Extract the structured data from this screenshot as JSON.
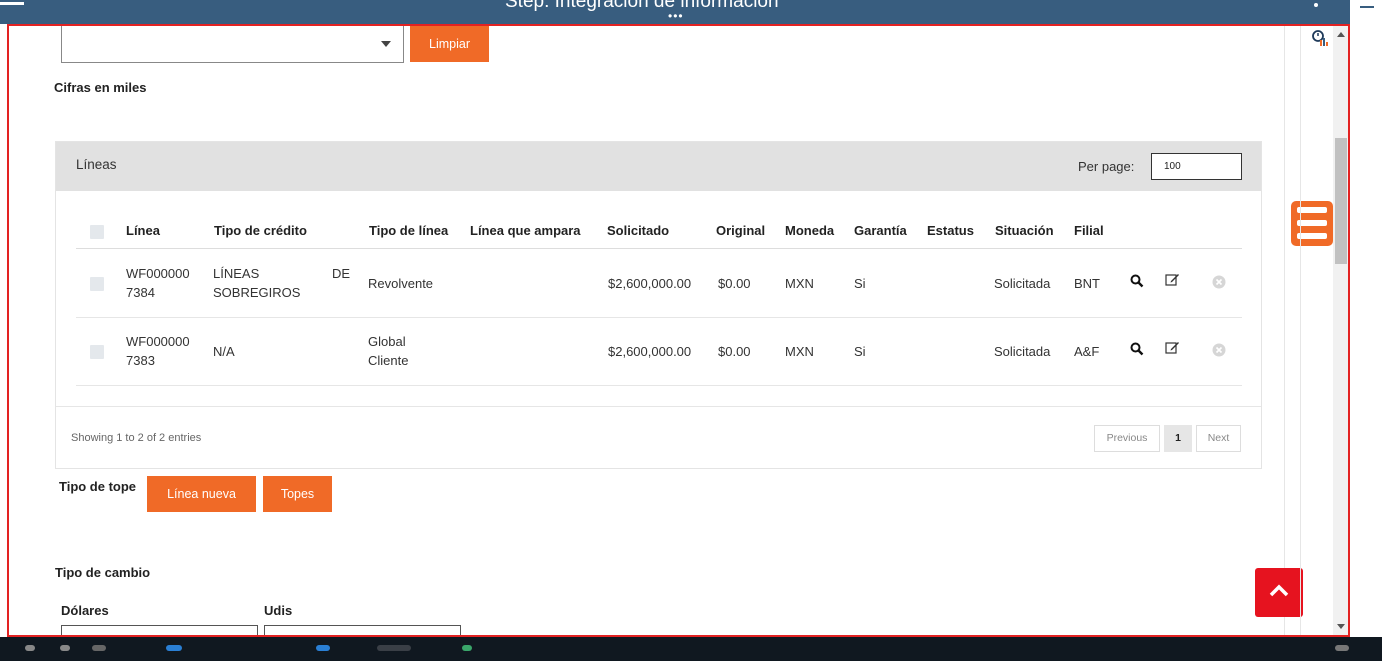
{
  "window": {
    "title": "Step: Integración de información"
  },
  "filters": {
    "select_value": "",
    "clear_button": "Limpiar",
    "note": "Cifras en miles"
  },
  "lines_panel": {
    "title": "Líneas",
    "per_page_label": "Per page:",
    "per_page_value": "100",
    "columns": [
      "Línea",
      "Tipo de crédito",
      "Tipo de línea",
      "Línea que ampara",
      "Solicitado",
      "Original",
      "Moneda",
      "Garantía",
      "Estatus",
      "Situación",
      "Filial"
    ],
    "rows": [
      {
        "linea_1": "WF000000",
        "linea_2": "7384",
        "tipo_credito_1": "LÍNEAS",
        "tipo_credito_de": "DE",
        "tipo_credito_2": "SOBREGIROS",
        "tipo_linea_1": "Revolvente",
        "tipo_linea_2": "",
        "linea_ampara": "",
        "solicitado": "$2,600,000.00",
        "original": "$0.00",
        "moneda": "MXN",
        "garantia": "Si",
        "estatus": "",
        "situacion": "Solicitada",
        "filial": "BNT"
      },
      {
        "linea_1": "WF000000",
        "linea_2": "7383",
        "tipo_credito_1": "N/A",
        "tipo_credito_de": "",
        "tipo_credito_2": "",
        "tipo_linea_1": "Global",
        "tipo_linea_2": "Cliente",
        "linea_ampara": "",
        "solicitado": "$2,600,000.00",
        "original": "$0.00",
        "moneda": "MXN",
        "garantia": "Si",
        "estatus": "",
        "situacion": "Solicitada",
        "filial": "A&F"
      }
    ],
    "footer_info": "Showing 1 to 2 of 2 entries",
    "pagination": {
      "previous": "Previous",
      "current": "1",
      "next": "Next"
    }
  },
  "tope": {
    "label": "Tipo de tope",
    "new_line_button": "Línea nueva",
    "topes_button": "Topes"
  },
  "exchange": {
    "title": "Tipo de cambio",
    "dollars_label": "Dólares",
    "udis_label": "Udis",
    "dollars_value": "",
    "udis_value": ""
  },
  "colors": {
    "accent": "#f06a27",
    "header_bar": "#385d7f",
    "scroll_top_button": "#e6131f",
    "frame_border": "#e32222"
  },
  "icons": [
    "menu-icon",
    "more-vertical-icon",
    "search-icon",
    "edit-icon",
    "remove-icon",
    "chevron-up-icon",
    "hamburger-menu-icon",
    "clock-chart-icon",
    "caret-down-icon"
  ]
}
